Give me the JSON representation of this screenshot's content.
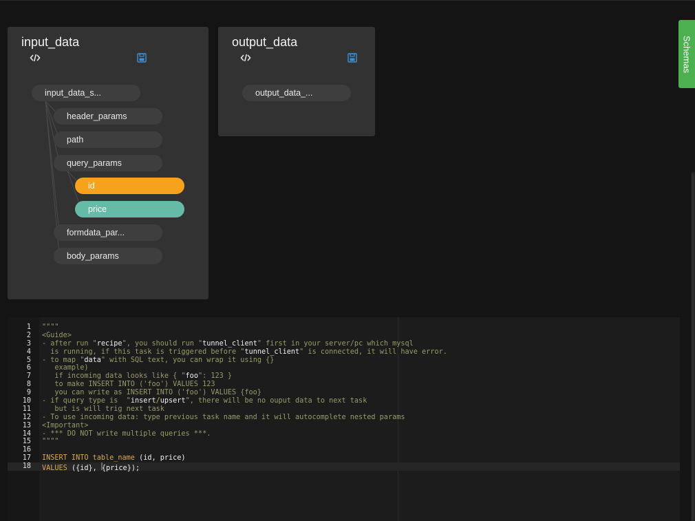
{
  "input_panel": {
    "title": "input_data",
    "icons": [
      "code-icon",
      "save-icon"
    ],
    "root": "input_data_s...",
    "children": [
      "header_params",
      "path",
      "query_params",
      "formdata_par...",
      "body_params"
    ],
    "query_children": [
      {
        "label": "id",
        "color": "#f6a21d"
      },
      {
        "label": "price",
        "color": "#66bba7"
      }
    ]
  },
  "output_panel": {
    "title": "output_data",
    "icons": [
      "code-icon",
      "save-icon"
    ],
    "root": "output_data_..."
  },
  "sidebar_tab": {
    "label": "Schemas",
    "color": "#4caf50"
  },
  "editor": {
    "line_numbers": [
      "1",
      "2",
      "3",
      "4",
      "5",
      "6",
      "7",
      "8",
      "9",
      "10",
      "11",
      "12",
      "13",
      "14",
      "15",
      "16",
      "17",
      "18"
    ],
    "lines": [
      "\"\"\"",
      "<Guide>",
      "- after run \"recipe\", you should run \"tunnel_client\" first in your server/pc which mysql",
      "  is running, if this task is triggered before \"tunnel_client\" is connected, it will have error.",
      "- to map \"data\" with SQL text, you can wrap it using {}",
      "   example)",
      "   if incoming data looks like { \"foo\": 123 }",
      "   to make INSERT INTO ('foo') VALUES 123",
      "   you can write as INSERT INTO ('foo') VALUES {foo}",
      "- if query type is  \"insert/upsert\", there will be no ouput data to next task",
      "   but is will trig next task",
      "- To use incoming data: type previous task name and it will autocomplete nested params",
      "<Important>",
      "- *** DO NOT write multiple queries ***.",
      "\"\"\"",
      "",
      "INSERT INTO table_name (id, price)",
      "VALUES ({id}, {price});"
    ],
    "active_line": 18
  }
}
